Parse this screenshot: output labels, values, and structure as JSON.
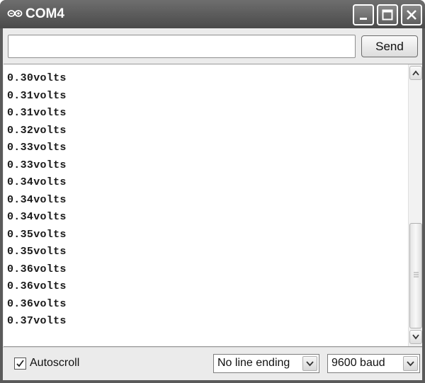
{
  "window": {
    "title": "COM4",
    "app_icon": "arduino-infinity-icon",
    "controls": [
      "minimize-icon",
      "maximize-icon",
      "close-icon"
    ]
  },
  "send_bar": {
    "input_value": "",
    "send_label": "Send"
  },
  "serial_output": {
    "lines": [
      "0.30volts",
      "0.31volts",
      "0.31volts",
      "0.32volts",
      "0.33volts",
      "0.33volts",
      "0.34volts",
      "0.34volts",
      "0.34volts",
      "0.35volts",
      "0.35volts",
      "0.36volts",
      "0.36volts",
      "0.36volts",
      "0.37volts"
    ]
  },
  "footer": {
    "autoscroll_label": "Autoscroll",
    "autoscroll_checked": true,
    "line_ending_value": "No line ending",
    "baud_value": "9600 baud"
  },
  "colors": {
    "titlebar": "#5a5a5a",
    "client_bg": "#ebebeb",
    "output_bg": "#ffffff"
  }
}
